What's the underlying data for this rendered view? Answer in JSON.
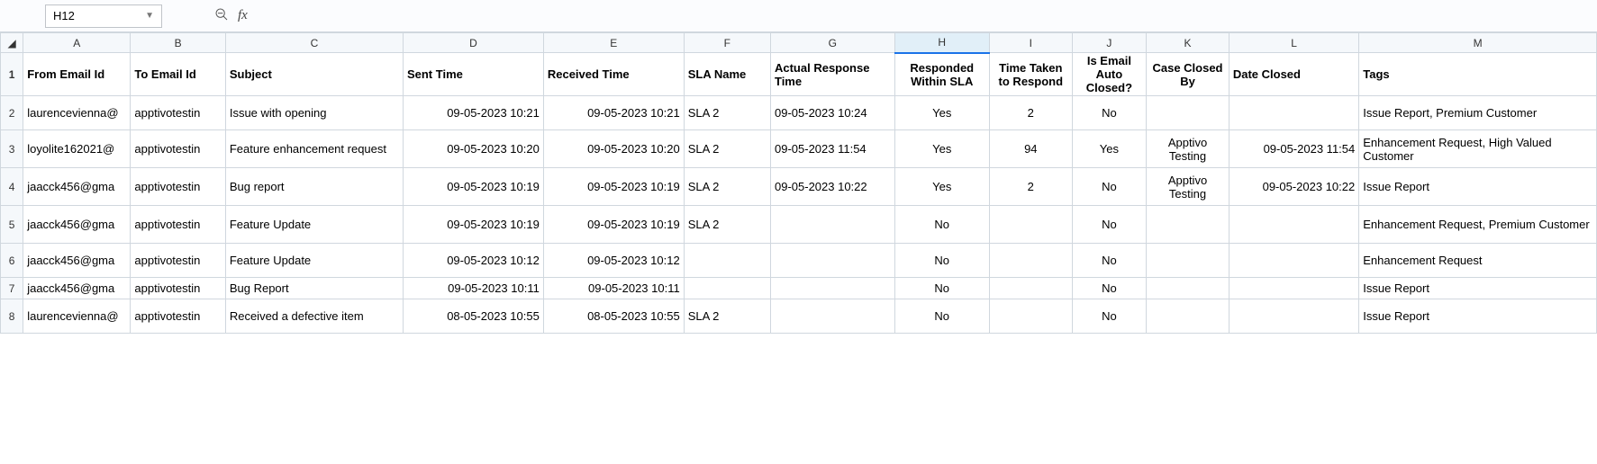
{
  "namebox": {
    "value": "H12"
  },
  "fx_label": "fx",
  "formula_value": "",
  "col_letters": [
    "A",
    "B",
    "C",
    "D",
    "E",
    "F",
    "G",
    "H",
    "I",
    "J",
    "K",
    "L",
    "M"
  ],
  "selected_col_index": 7,
  "row_numbers": [
    "1",
    "2",
    "3",
    "4",
    "5",
    "6",
    "7",
    "8"
  ],
  "headers": {
    "from_email": "From Email Id",
    "to_email": "To Email Id",
    "subject": "Subject",
    "sent_time": "Sent Time",
    "received_time": "Received Time",
    "sla_name": "SLA Name",
    "actual_response": "Actual Response Time",
    "responded": "Responded Within SLA",
    "time_taken": "Time Taken to Respond",
    "auto_closed": "Is Email Auto Closed?",
    "closed_by": "Case Closed By",
    "date_closed": "Date Closed",
    "tags": "Tags"
  },
  "rows": [
    {
      "from_email": "laurencevienna@",
      "to_email": "apptivotestin",
      "subject": "Issue with opening",
      "sent_time": "09-05-2023 10:21",
      "received_time": "09-05-2023 10:21",
      "sla_name": "SLA 2",
      "actual_response": "09-05-2023 10:24",
      "responded": "Yes",
      "time_taken": "2",
      "auto_closed": "No",
      "closed_by": "",
      "date_closed": "",
      "tags": "Issue Report, Premium Customer"
    },
    {
      "from_email": "loyolite162021@",
      "to_email": "apptivotestin",
      "subject": "Feature enhancement request",
      "sent_time": "09-05-2023 10:20",
      "received_time": "09-05-2023 10:20",
      "sla_name": "SLA 2",
      "actual_response": "09-05-2023 11:54",
      "responded": "Yes",
      "time_taken": "94",
      "auto_closed": "Yes",
      "closed_by": "Apptivo Testing",
      "date_closed": "09-05-2023 11:54",
      "tags": "Enhancement Request, High Valued Customer"
    },
    {
      "from_email": "jaacck456@gma",
      "to_email": "apptivotestin",
      "subject": "Bug report",
      "sent_time": "09-05-2023 10:19",
      "received_time": "09-05-2023 10:19",
      "sla_name": "SLA 2",
      "actual_response": "09-05-2023 10:22",
      "responded": "Yes",
      "time_taken": "2",
      "auto_closed": "No",
      "closed_by": "Apptivo Testing",
      "date_closed": "09-05-2023 10:22",
      "tags": "Issue Report"
    },
    {
      "from_email": "jaacck456@gma",
      "to_email": "apptivotestin",
      "subject": "Feature Update",
      "sent_time": "09-05-2023 10:19",
      "received_time": "09-05-2023 10:19",
      "sla_name": "SLA 2",
      "actual_response": "",
      "responded": "No",
      "time_taken": "",
      "auto_closed": "No",
      "closed_by": "",
      "date_closed": "",
      "tags": "Enhancement Request, Premium Customer"
    },
    {
      "from_email": "jaacck456@gma",
      "to_email": "apptivotestin",
      "subject": "Feature Update",
      "sent_time": "09-05-2023 10:12",
      "received_time": "09-05-2023 10:12",
      "sla_name": "",
      "actual_response": "",
      "responded": "No",
      "time_taken": "",
      "auto_closed": "No",
      "closed_by": "",
      "date_closed": "",
      "tags": "Enhancement Request"
    },
    {
      "from_email": "jaacck456@gma",
      "to_email": "apptivotestin",
      "subject": "Bug Report",
      "sent_time": "09-05-2023 10:11",
      "received_time": "09-05-2023 10:11",
      "sla_name": "",
      "actual_response": "",
      "responded": "No",
      "time_taken": "",
      "auto_closed": "No",
      "closed_by": "",
      "date_closed": "",
      "tags": "Issue Report"
    },
    {
      "from_email": "laurencevienna@",
      "to_email": "apptivotestin",
      "subject": "Received a defective item",
      "sent_time": "08-05-2023 10:55",
      "received_time": "08-05-2023 10:55",
      "sla_name": "SLA 2",
      "actual_response": "",
      "responded": "No",
      "time_taken": "",
      "auto_closed": "No",
      "closed_by": "",
      "date_closed": "",
      "tags": "Issue Report"
    }
  ]
}
